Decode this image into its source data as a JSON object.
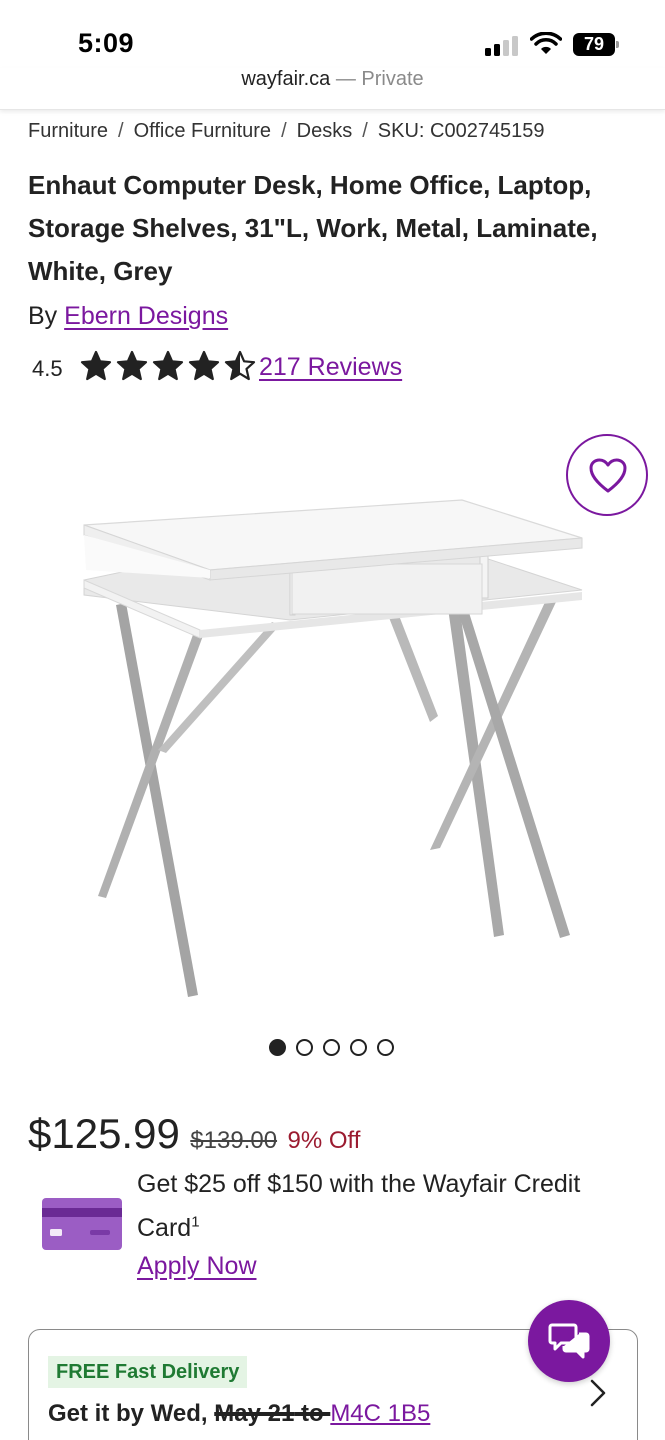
{
  "status_bar": {
    "time": "5:09",
    "battery": "79"
  },
  "browser": {
    "domain": "wayfair.ca",
    "separator": "—",
    "mode": "Private"
  },
  "breadcrumb": {
    "items": [
      "Furniture",
      "Office Furniture",
      "Desks",
      "SKU: C002745159"
    ],
    "separator": "/"
  },
  "product": {
    "title": "Enhaut Computer Desk, Home Office, Laptop, Storage Shelves, 31\"L, Work, Metal, Laminate, White, Grey",
    "by_label": "By",
    "brand": "Ebern Designs",
    "rating": "4.5",
    "rating_value": 4.5,
    "rating_max": 5,
    "reviews_link": "217 Reviews",
    "image_icon": "desk-product-image",
    "gallery": {
      "total": 5,
      "active_index": 0
    }
  },
  "pricing": {
    "price": "$125.99",
    "was_price": "$139.00",
    "discount": "9% Off"
  },
  "credit_offer": {
    "text": "Get $25 off $150 with the Wayfair Credit Card",
    "superscript": "1",
    "apply_link": "Apply Now",
    "icon": "credit-card-icon"
  },
  "delivery": {
    "badge": "FREE Fast Delivery",
    "prefix": "Get it by Wed, ",
    "date": "May 21",
    "to": " to ",
    "zip": "M4C 1B5"
  },
  "colors": {
    "brand_purple": "#7b189f",
    "discount_red": "#9b1b30",
    "delivery_green": "#1f7a33"
  }
}
